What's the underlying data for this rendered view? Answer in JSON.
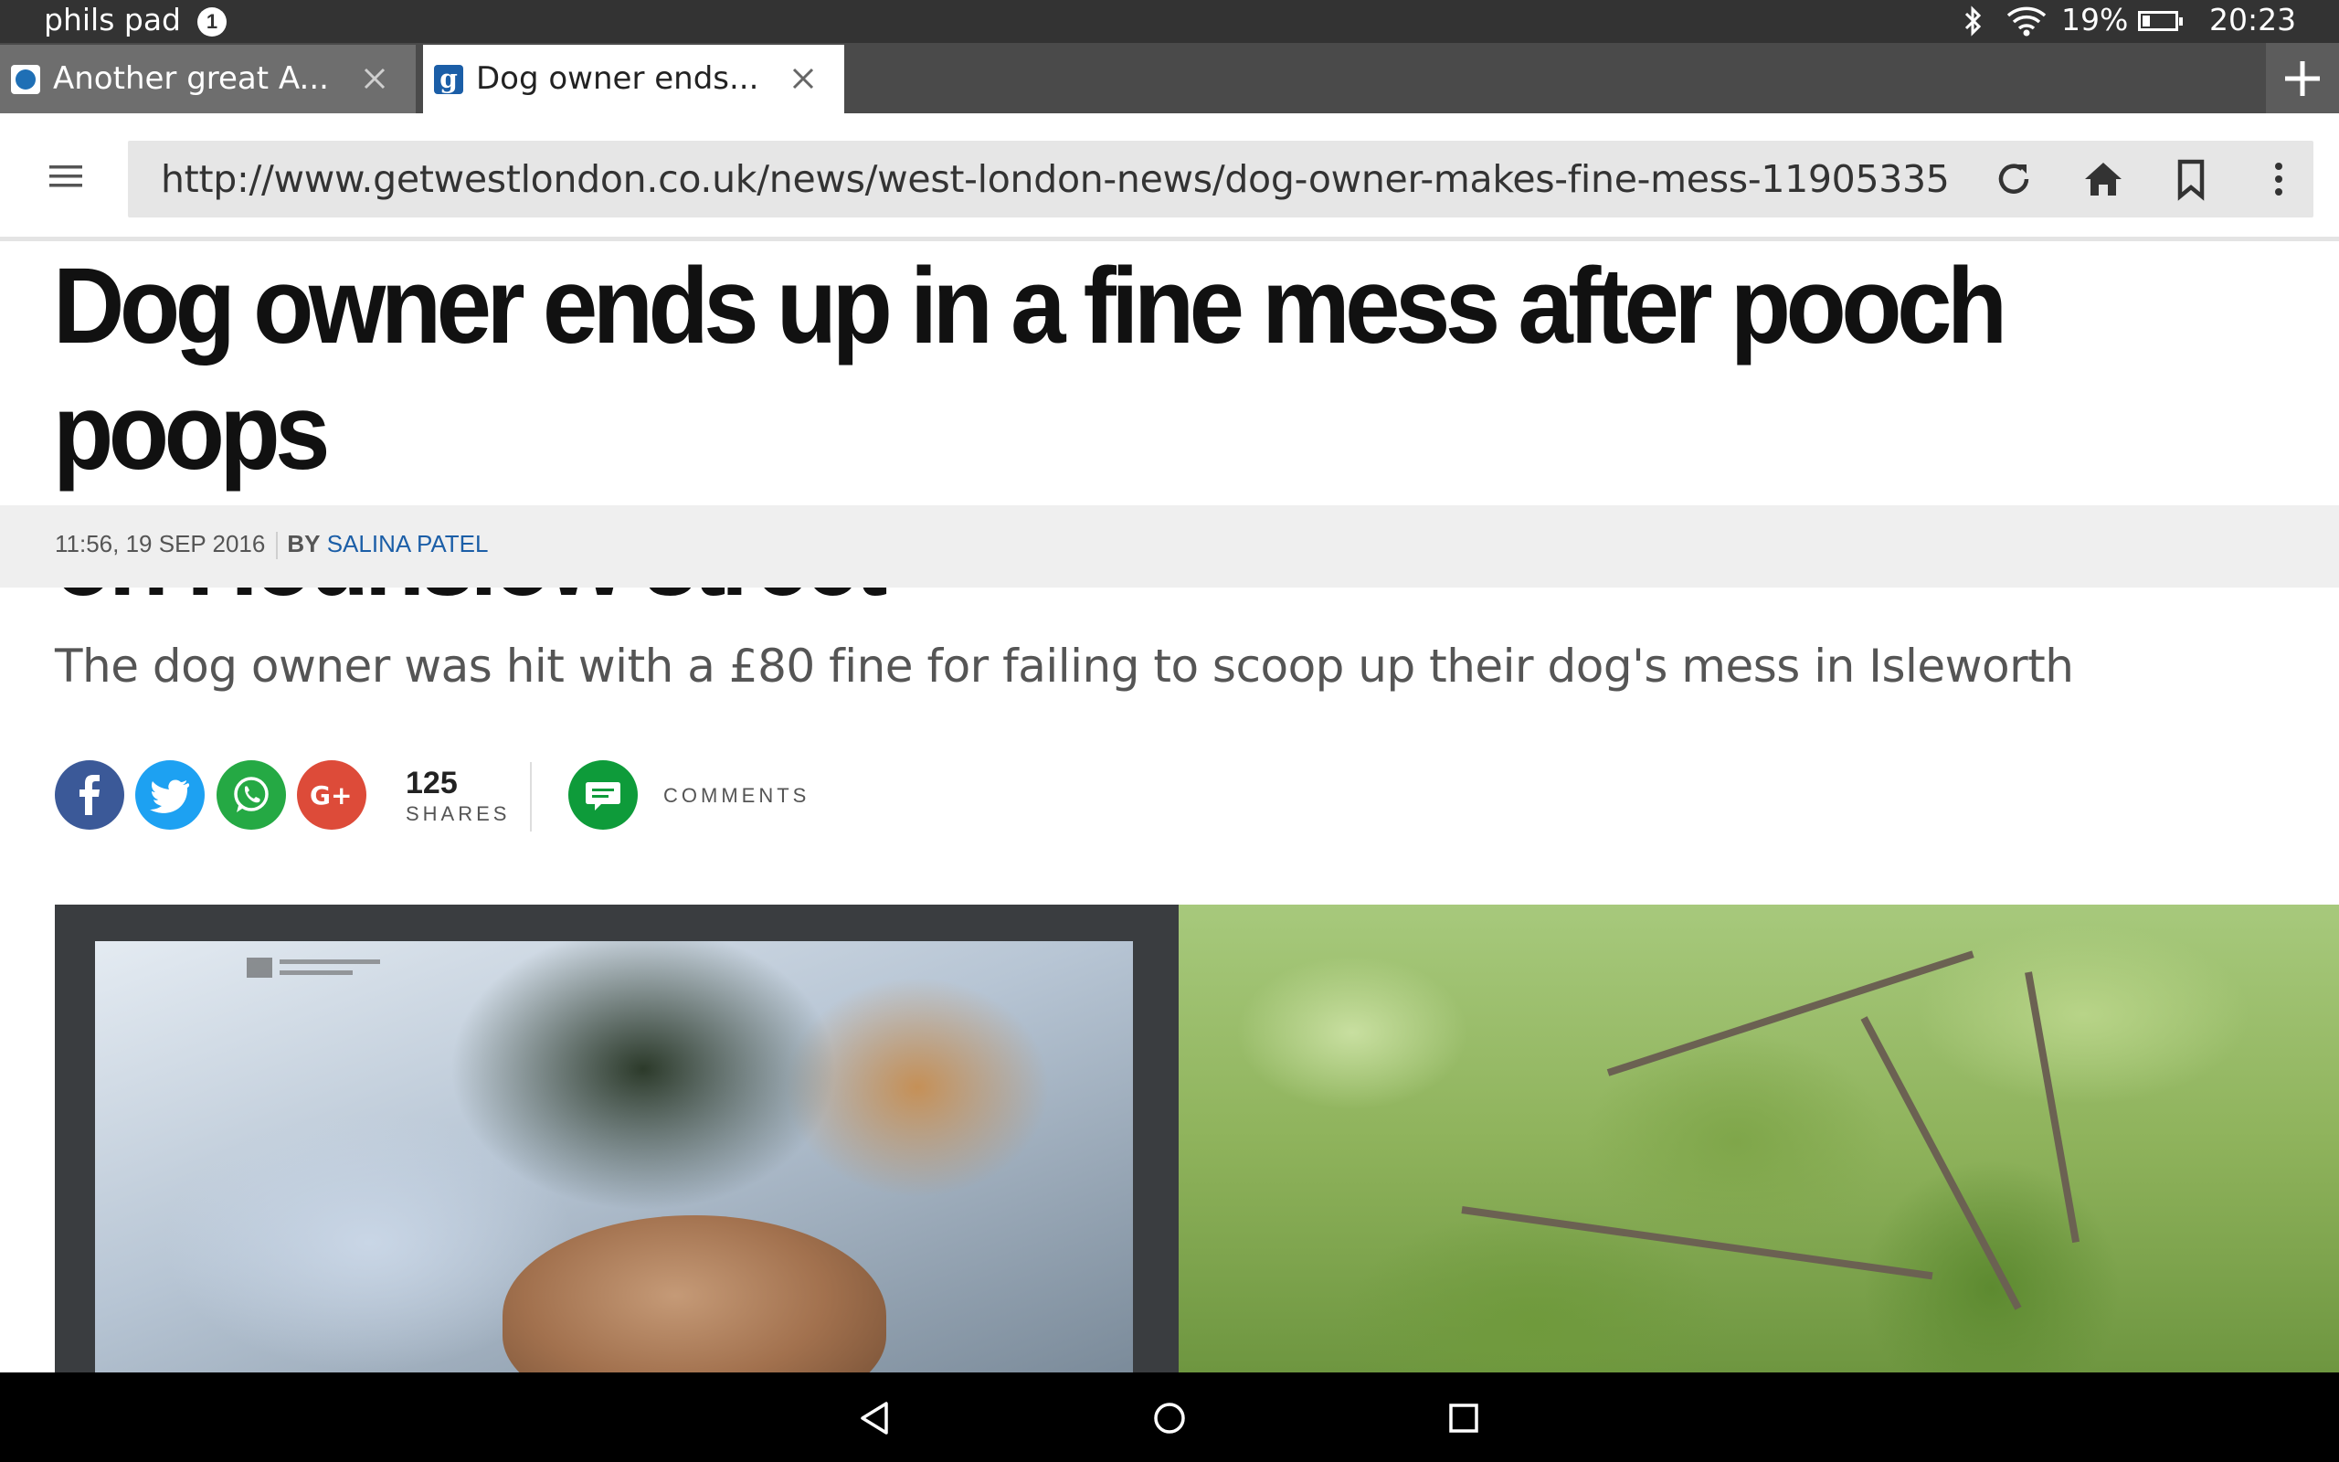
{
  "status_bar": {
    "device_name": "phils pad",
    "notification_count": "1",
    "battery_percent": "19%",
    "battery_level": 0.19,
    "time": "20:23",
    "icons": [
      "bluetooth-icon",
      "wifi-icon",
      "battery-icon"
    ]
  },
  "tabs": [
    {
      "title": "Another great A...",
      "active": false,
      "favicon": "circle-logo-icon"
    },
    {
      "title": "Dog owner ends...",
      "active": true,
      "favicon": "g-logo-icon"
    }
  ],
  "address_bar": {
    "url": "http://www.getwestlondon.co.uk/news/west-london-news/dog-owner-makes-fine-mess-11905335",
    "buttons": [
      "reload-icon",
      "home-icon",
      "bookmark-icon",
      "overflow-menu-icon"
    ]
  },
  "article": {
    "headline_line1": "Dog owner ends up in a fine mess after pooch poops",
    "headline_line2": "on Hounslow street",
    "timestamp": "11:56, 19 SEP 2016",
    "by_label": "BY",
    "author": "SALINA PATEL",
    "standfirst": "The dog owner was hit with a £80 fine for failing to scoop up their dog's mess in Isleworth",
    "share": {
      "count": "125",
      "label": "SHARES",
      "comments_label": "COMMENTS"
    }
  },
  "colors": {
    "facebook": "#3b5998",
    "twitter": "#1da1f2",
    "whatsapp": "#25a944",
    "google_plus": "#dd4b39",
    "comments": "#0e9b3a",
    "author_link": "#1b5ea7"
  }
}
